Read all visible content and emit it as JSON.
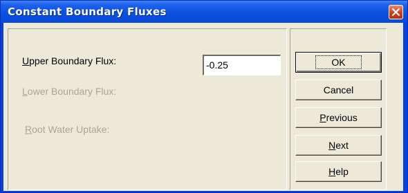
{
  "window": {
    "title": "Constant Boundary Fluxes"
  },
  "form": {
    "upper_flux": {
      "label_prefix": "",
      "label_accel": "U",
      "label_rest": "pper Boundary Flux:",
      "value": "-0.25"
    },
    "lower_flux": {
      "label_accel": "L",
      "label_rest": "ower Boundary Flux:"
    },
    "root_uptake": {
      "label_accel": "R",
      "label_rest": "oot Water Uptake:"
    }
  },
  "buttons": {
    "ok": "OK",
    "cancel": "Cancel",
    "previous": {
      "accel": "P",
      "rest": "revious"
    },
    "next": {
      "accel": "N",
      "rest": "ext"
    },
    "help": {
      "accel": "H",
      "rest": "elp"
    }
  },
  "colors": {
    "title_bar": "#0a4ad8",
    "client_bg": "#ece9d8",
    "disabled_text": "#a9a59a",
    "close_button": "#cf3e1b"
  }
}
